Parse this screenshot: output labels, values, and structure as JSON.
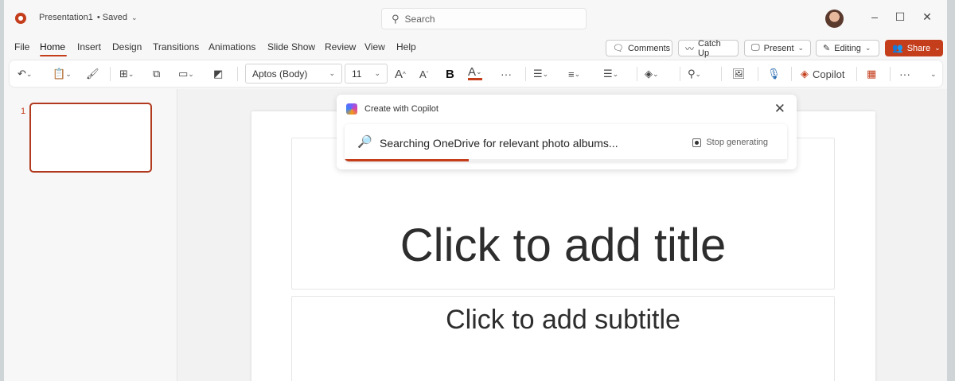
{
  "titlebar": {
    "doc_title": "Presentation1",
    "doc_status": "• Saved",
    "search_placeholder": "Search"
  },
  "menu": {
    "items": [
      "File",
      "Home",
      "Insert",
      "Design",
      "Transitions",
      "Animations",
      "Slide Show",
      "Review",
      "View",
      "Help"
    ],
    "active": "Home",
    "comments": "Comments",
    "catchup": "Catch Up",
    "present": "Present",
    "editing": "Editing",
    "share": "Share"
  },
  "ribbon": {
    "font_name": "Aptos (Body)",
    "font_size": "11",
    "grow_font": "A",
    "shrink_font": "A",
    "bold": "B",
    "font_color": "A",
    "more": "···",
    "copilot": "Copilot",
    "overflow": "···"
  },
  "panel": {
    "slide_number": "1"
  },
  "slide": {
    "title_placeholder": "Click to add title",
    "subtitle_placeholder": "Click to add subtitle"
  },
  "copilot": {
    "header": "Create with Copilot",
    "status": "Searching OneDrive for relevant photo albums...",
    "stop": "Stop generating",
    "progress": 0.28
  },
  "colors": {
    "accent": "#c43e1c"
  }
}
